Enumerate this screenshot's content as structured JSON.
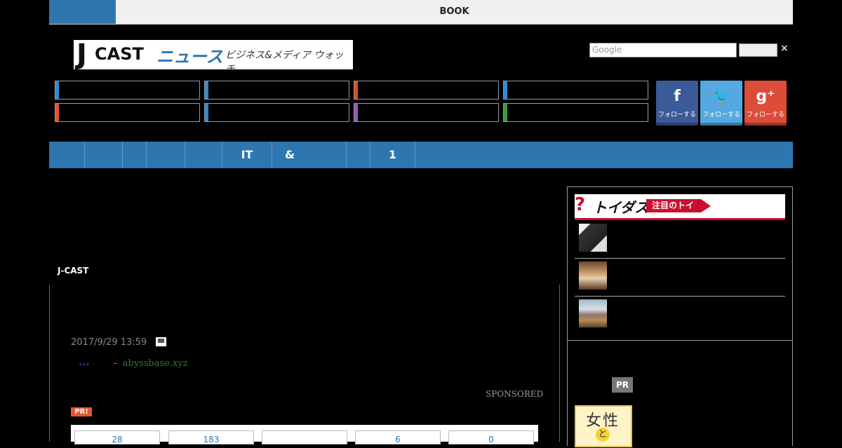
{
  "topbar": {
    "center_label": "BOOK"
  },
  "logo": {
    "mark": "J",
    "brand": "CAST",
    "brand2": "ニュース",
    "tagline": "ビジネス&メディア ウォッチ"
  },
  "search": {
    "placeholder": "Google",
    "close": "×"
  },
  "categories": {
    "stripe_colors": [
      "#2e8bd6",
      "#2e8bd6",
      "#e04a2d",
      "#2e8bd6",
      "#e8552e",
      "#2e8bd6",
      "#9b59b6",
      "#3a9a3a"
    ]
  },
  "social": [
    {
      "glyph": "f",
      "label": "フォローする",
      "color": "#3b5a98"
    },
    {
      "glyph": "🐦",
      "label": "フォローする",
      "color": "#55a9e0"
    },
    {
      "glyph": "g⁺",
      "label": "フォローする",
      "color": "#dd4b39"
    }
  ],
  "nav": {
    "items": [
      "",
      "",
      "",
      "",
      "",
      "IT",
      "&",
      "",
      "1",
      ""
    ]
  },
  "article": {
    "section_label": "J-CAST",
    "date": "2017/9/29 13:59",
    "ad_dots": "...",
    "ad_sep": "-",
    "ad_domain": "abyssbase.xyz",
    "sponsored": "SPONSORED",
    "pr_badge": "PR!",
    "counts": [
      "28",
      "183",
      "",
      "6",
      "0"
    ]
  },
  "sidebar": {
    "toigus_q": "?",
    "toigus_name": "トイダス",
    "toigus_chip": "注目のトイ",
    "pr_label": "PR",
    "book_title": "女性",
    "book_sub": "と"
  }
}
